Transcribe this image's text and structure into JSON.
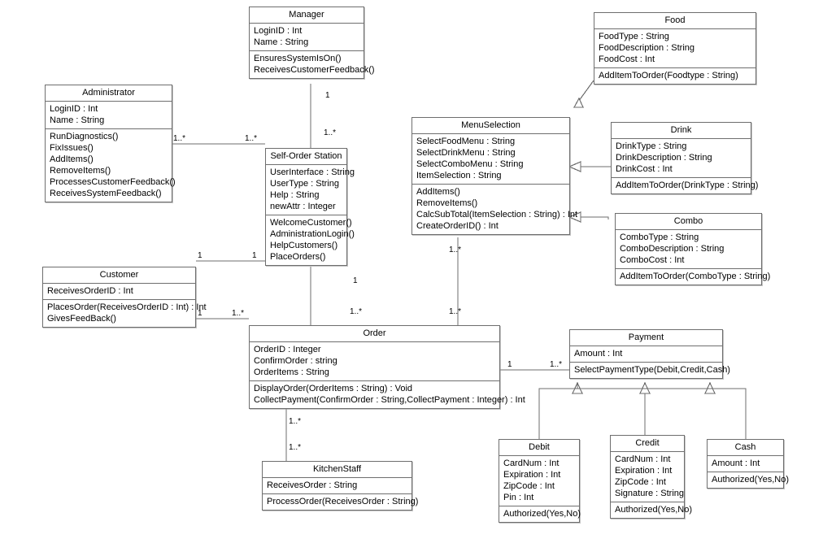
{
  "diagram": {
    "title": "Self-Order Station UML Class Diagram",
    "type": "uml-class-diagram",
    "stroke_color": "#6e6e6e",
    "text_color": "#000000",
    "background": "#ffffff"
  },
  "classes": [
    {
      "id": "manager",
      "name": "Manager",
      "attributes": [
        "LoginID : Int",
        "Name : String"
      ],
      "operations": [
        "EnsuresSystemIsOn()",
        "ReceivesCustomerFeedback()"
      ]
    },
    {
      "id": "food",
      "name": "Food",
      "attributes": [
        "FoodType : String",
        "FoodDescription : String",
        "FoodCost : Int"
      ],
      "operations": [
        "AddItemToOrder(Foodtype : String)"
      ]
    },
    {
      "id": "administrator",
      "name": "Administrator",
      "attributes": [
        "LoginID : Int",
        "Name : String"
      ],
      "operations": [
        "RunDiagnostics()",
        "FixIssues()",
        "AddItems()",
        "RemoveItems()",
        "ProcessesCustomerFeedback()",
        "ReceivesSystemFeedback()"
      ]
    },
    {
      "id": "menuselection",
      "name": "MenuSelection",
      "attributes": [
        "SelectFoodMenu : String",
        "SelectDrinkMenu : String",
        "SelectComboMenu : String",
        "ItemSelection : String"
      ],
      "operations": [
        "AddItems()",
        "RemoveItems()",
        "CalcSubTotal(ItemSelection : String) : Int",
        "CreateOrderID() : Int"
      ]
    },
    {
      "id": "drink",
      "name": "Drink",
      "attributes": [
        "DrinkType : String",
        "DrinkDescription : String",
        "DrinkCost : Int"
      ],
      "operations": [
        "AddItemToOrder(DrinkType : String)"
      ]
    },
    {
      "id": "selforderstation",
      "name": "Self-Order Station",
      "attributes": [
        "UserInterface : String",
        "UserType : String",
        "Help : String",
        "newAttr : Integer"
      ],
      "operations": [
        "WelcomeCustomer()",
        "AdministrationLogin()",
        "HelpCustomers()",
        "PlaceOrders()"
      ]
    },
    {
      "id": "combo",
      "name": "Combo",
      "attributes": [
        "ComboType : String",
        "ComboDescription : String",
        "ComboCost : Int"
      ],
      "operations": [
        "AddItemToOrder(ComboType : String)"
      ]
    },
    {
      "id": "customer",
      "name": "Customer",
      "attributes": [
        "ReceivesOrderID : Int"
      ],
      "operations": [
        "PlacesOrder(ReceivesOrderID : Int) : Int",
        "GivesFeedBack()"
      ]
    },
    {
      "id": "order",
      "name": "Order",
      "attributes": [
        "OrderID : Integer",
        "ConfirmOrder : string",
        "OrderItems : String"
      ],
      "operations": [
        "DisplayOrder(OrderItems : String) : Void",
        "CollectPayment(ConfirmOrder : String,CollectPayment : Integer) : Int"
      ]
    },
    {
      "id": "payment",
      "name": "Payment",
      "attributes": [
        "Amount : Int"
      ],
      "operations": [
        "SelectPaymentType(Debit,Credit,Cash)"
      ]
    },
    {
      "id": "debit",
      "name": "Debit",
      "attributes": [
        "CardNum : Int",
        "Expiration : Int",
        "ZipCode : Int",
        "Pin : Int"
      ],
      "operations": [
        "Authorized(Yes,No)"
      ]
    },
    {
      "id": "credit",
      "name": "Credit",
      "attributes": [
        "CardNum : Int",
        "Expiration : Int",
        "ZipCode : Int",
        "Signature : String"
      ],
      "operations": [
        "Authorized(Yes,No)"
      ]
    },
    {
      "id": "cash",
      "name": "Cash",
      "attributes": [
        "Amount : Int"
      ],
      "operations": [
        "Authorized(Yes,No)"
      ]
    },
    {
      "id": "kitchenstaff",
      "name": "KitchenStaff",
      "attributes": [
        "ReceivesOrder : String"
      ],
      "operations": [
        "ProcessOrder(ReceivesOrder : String)"
      ]
    }
  ],
  "multiplicities": [
    {
      "id": "m1",
      "label": "1",
      "from": "manager",
      "to": "selforderstation"
    },
    {
      "id": "m2",
      "label": "1..*",
      "from": "selforderstation",
      "to": "manager"
    },
    {
      "id": "m3",
      "label": "1..*",
      "from": "administrator",
      "to": "selforderstation"
    },
    {
      "id": "m4",
      "label": "1..*",
      "from": "selforderstation",
      "to": "administrator"
    },
    {
      "id": "m5",
      "label": "1",
      "from": "customer",
      "to": "selforderstation"
    },
    {
      "id": "m6",
      "label": "1",
      "from": "selforderstation",
      "to": "customer"
    },
    {
      "id": "m7",
      "label": "1",
      "from": "customer",
      "to": "order"
    },
    {
      "id": "m8",
      "label": "1..*",
      "from": "order",
      "to": "customer"
    },
    {
      "id": "m9",
      "label": "1",
      "from": "selforderstation",
      "to": "order"
    },
    {
      "id": "m10",
      "label": "1..*",
      "from": "order",
      "to": "selforderstation"
    },
    {
      "id": "m11",
      "label": "1..*",
      "from": "menuselection",
      "to": "order"
    },
    {
      "id": "m12",
      "label": "1..*",
      "from": "order",
      "to": "menuselection"
    },
    {
      "id": "m13",
      "label": "1",
      "from": "order",
      "to": "payment"
    },
    {
      "id": "m14",
      "label": "1..*",
      "from": "payment",
      "to": "order"
    },
    {
      "id": "m15",
      "label": "1..*",
      "from": "order",
      "to": "kitchenstaff"
    },
    {
      "id": "m16",
      "label": "1..*",
      "from": "kitchenstaff",
      "to": "order"
    }
  ],
  "relationships": [
    {
      "kind": "generalization",
      "from": "food",
      "to": "menuselection"
    },
    {
      "kind": "generalization",
      "from": "drink",
      "to": "menuselection"
    },
    {
      "kind": "generalization",
      "from": "combo",
      "to": "menuselection"
    },
    {
      "kind": "generalization",
      "from": "debit",
      "to": "payment"
    },
    {
      "kind": "generalization",
      "from": "credit",
      "to": "payment"
    },
    {
      "kind": "generalization",
      "from": "cash",
      "to": "payment"
    },
    {
      "kind": "association",
      "from": "manager",
      "to": "selforderstation"
    },
    {
      "kind": "association",
      "from": "administrator",
      "to": "selforderstation"
    },
    {
      "kind": "association",
      "from": "customer",
      "to": "selforderstation"
    },
    {
      "kind": "association",
      "from": "customer",
      "to": "order"
    },
    {
      "kind": "association",
      "from": "selforderstation",
      "to": "order"
    },
    {
      "kind": "association",
      "from": "menuselection",
      "to": "order"
    },
    {
      "kind": "association",
      "from": "order",
      "to": "payment"
    },
    {
      "kind": "association",
      "from": "order",
      "to": "kitchenstaff"
    }
  ]
}
